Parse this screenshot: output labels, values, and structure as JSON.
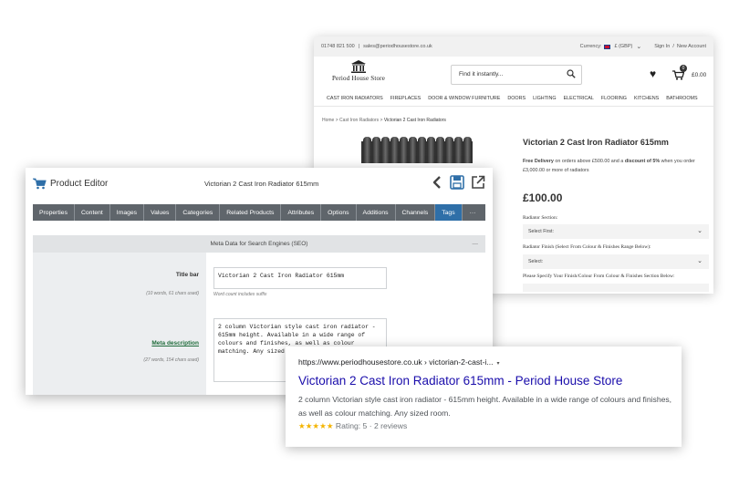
{
  "shop": {
    "phone": "01748 821 500",
    "separator": "|",
    "email": "sales@periodhousestore.co.uk",
    "currency_label": "Currency:",
    "currency_value": "£ (GBP)",
    "sign_in": "Sign In",
    "account_sep": "/",
    "new_account": "New Account",
    "logo_text": "Period House Store",
    "search_placeholder": "Find it instantly...",
    "cart_count": "0",
    "cart_total": "£0.00",
    "nav": [
      "CAST IRON RADIATORS",
      "FIREPLACES",
      "DOOR & WINDOW FURNITURE",
      "DOORS",
      "LIGHTING",
      "ELECTRICAL",
      "FLOORING",
      "KITCHENS",
      "BATHROOMS"
    ],
    "breadcrumb": [
      "Home",
      "Cast Iron Radiators",
      "Victorian 2 Cast Iron Radiators"
    ],
    "breadcrumb_sep": ">",
    "product_title": "Victorian 2 Cast Iron Radiator 615mm",
    "delivery": {
      "bold1": "Free Delivery",
      "text1": " on orders above £500.00 and a ",
      "bold2": "discount of 5%",
      "text2": " when you order £3,000.00 or more of radiators"
    },
    "price": "£100.00",
    "section_label": "Radiator Section:",
    "section_select": "Select First:",
    "finish_label": "Radiator Finish (Select From Colour & Finishes Range Below):",
    "finish_select": "Select:",
    "specify_label": "Please Specify Your Finish/Colour From Colour & Finishes Section Below:"
  },
  "editor": {
    "app_title": "Product Editor",
    "product_name": "Victorian 2 Cast Iron Radiator 615mm",
    "tabs": [
      "Properties",
      "Content",
      "Images",
      "Values",
      "Categories",
      "Related Products",
      "Attributes",
      "Options",
      "Additions",
      "Channels",
      "Tags",
      "···"
    ],
    "active_tab": "Tags",
    "section_title": "Meta Data for Search Engines  (SEO)",
    "section_collapse": "—",
    "title_bar_label": "Title bar",
    "title_bar_note": "(10 words, 61 chars used)",
    "title_bar_value": "Victorian 2 Cast Iron Radiator 615mm",
    "title_bar_hint": "Word count includes suffix",
    "meta_label": "Meta description",
    "meta_note": "(27 words, 154 chars used)",
    "meta_value": "2 column Victorian style cast iron radiator -\n615mm height. Available in a wide range of\ncolours and finishes, as well as colour\nmatching. Any sized"
  },
  "serp": {
    "url": "https://www.periodhousestore.co.uk › victorian-2-cast-i...",
    "caret": "▾",
    "title": "Victorian 2 Cast Iron Radiator 615mm - Period House Store",
    "description": "2 column Victorian style cast iron radiator - 615mm height. Available in a wide range of colours and finishes, as well as colour matching. Any sized room.",
    "stars": "★★★★★",
    "rating": "Rating: 5 · 2 reviews"
  },
  "colors": {
    "tab_bar": "#5f656b",
    "tab_active": "#2f6fa8",
    "serp_title": "#1a0dab",
    "serp_stars": "#f4b400",
    "meta_link": "#1e6b3a"
  }
}
